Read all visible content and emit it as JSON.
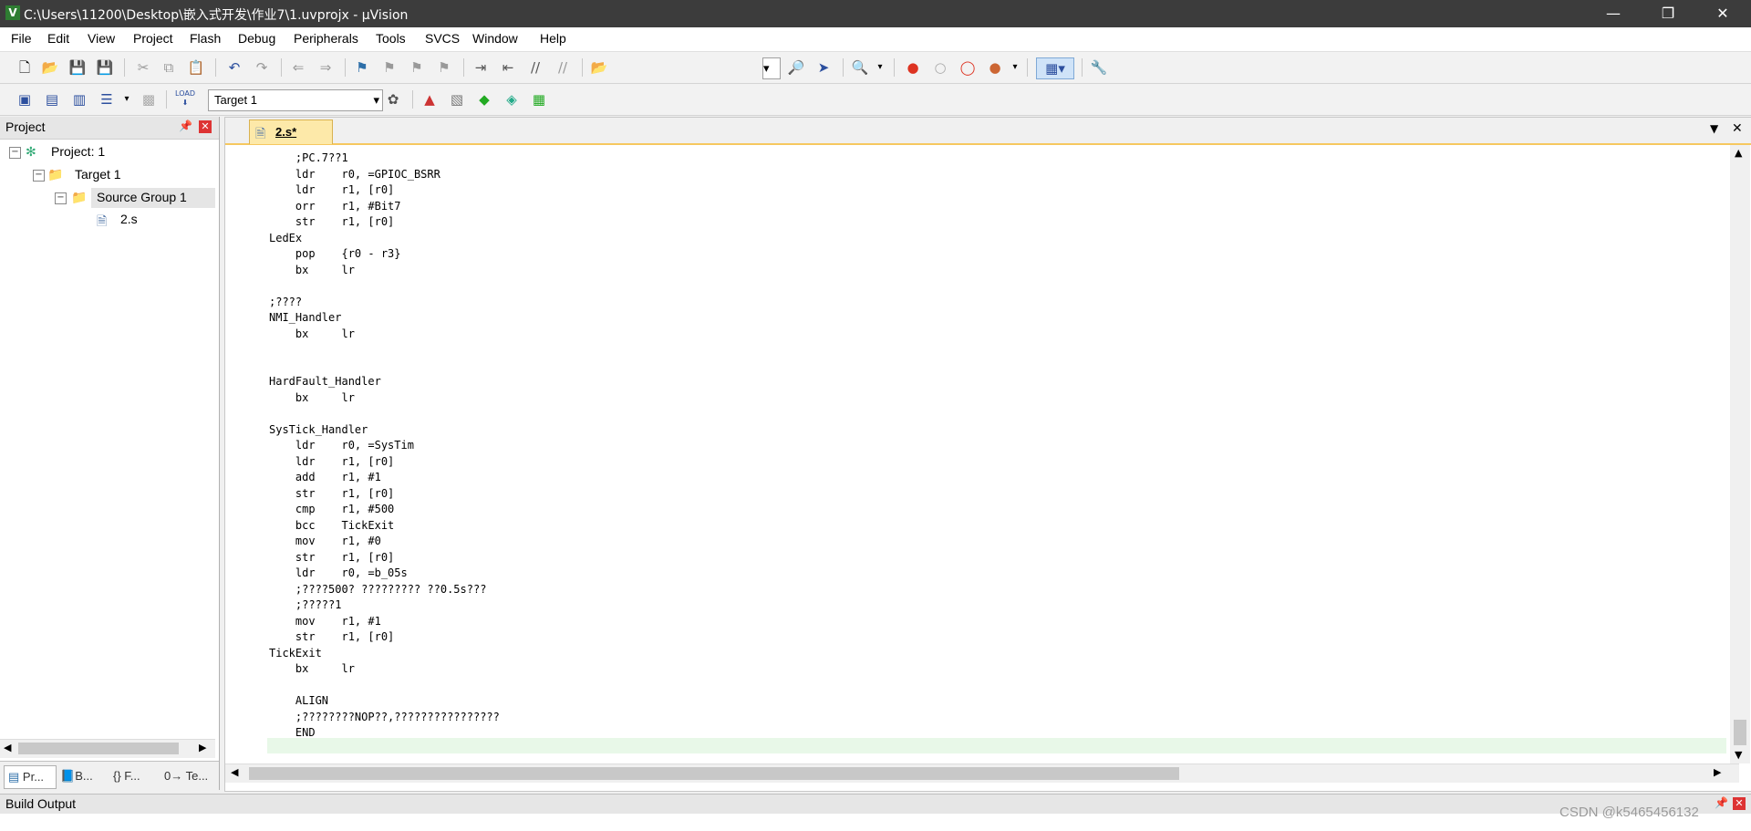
{
  "window": {
    "title": "C:\\Users\\11200\\Desktop\\嵌入式开发\\作业7\\1.uvprojx - µVision"
  },
  "menu": [
    "File",
    "Edit",
    "View",
    "Project",
    "Flash",
    "Debug",
    "Peripherals",
    "Tools",
    "SVCS",
    "Window",
    "Help"
  ],
  "toolbar2": {
    "target_select": "Target 1",
    "load_label": "LOAD"
  },
  "project_panel": {
    "title": "Project",
    "tree": {
      "project": "Project: 1",
      "target": "Target 1",
      "group": "Source Group 1",
      "file": "2.s"
    },
    "tabs": [
      "Pr...",
      "B...",
      "{} F...",
      "0→ Te..."
    ]
  },
  "editor": {
    "tab_label": "2.s*",
    "lines": [
      "    ;PC.7??1",
      "    ldr    r0, =GPIOC_BSRR",
      "    ldr    r1, [r0]",
      "    orr    r1, #Bit7",
      "    str    r1, [r0]",
      "LedEx",
      "    pop    {r0 - r3}",
      "    bx     lr",
      "",
      ";????",
      "NMI_Handler",
      "    bx     lr",
      "",
      "",
      "HardFault_Handler",
      "    bx     lr",
      "",
      "SysTick_Handler",
      "    ldr    r0, =SysTim",
      "    ldr    r1, [r0]",
      "    add    r1, #1",
      "    str    r1, [r0]",
      "    cmp    r1, #500",
      "    bcc    TickExit",
      "    mov    r1, #0",
      "    str    r1, [r0]",
      "    ldr    r0, =b_05s",
      "    ;????500? ????????? ??0.5s???",
      "    ;?????1",
      "    mov    r1, #1",
      "    str    r1, [r0]",
      "TickExit",
      "    bx     lr",
      "",
      "    ALIGN",
      "    ;????????NOP??,????????????????",
      "    END"
    ]
  },
  "build_output": {
    "title": "Build Output"
  },
  "watermark": "CSDN @k5465456132",
  "colors": {
    "titlebar": "#3c3c3c",
    "tab_active": "#fde9a9",
    "current_line": "#e8f8e8"
  }
}
